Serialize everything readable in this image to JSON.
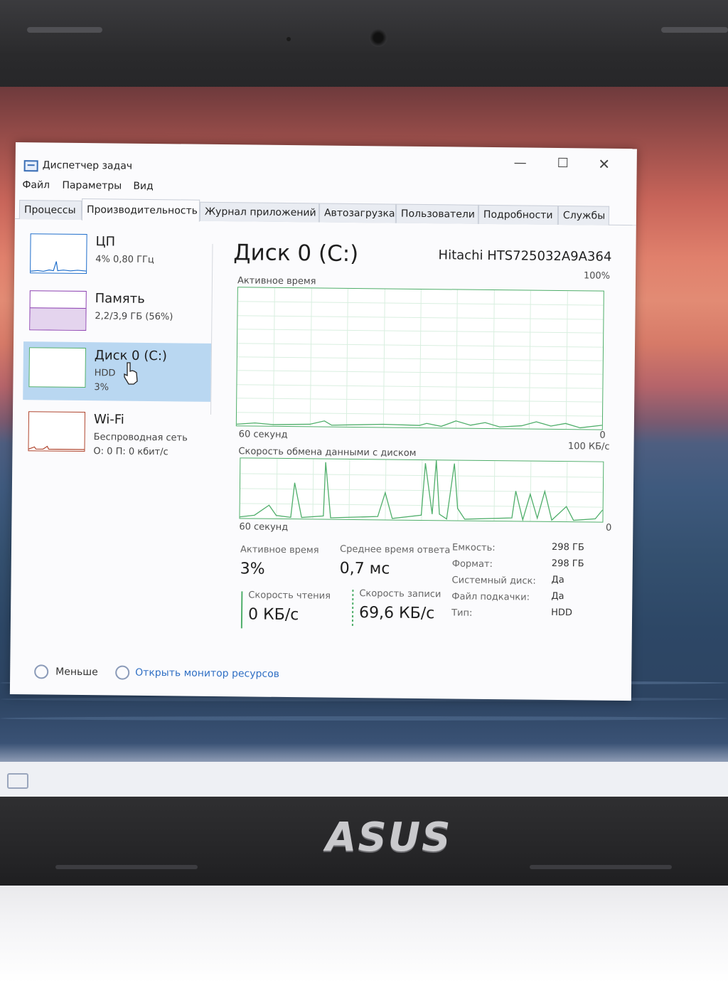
{
  "window": {
    "title": "Диспетчер задач",
    "controls": {
      "minimize": "—",
      "maximize": "☐",
      "close": "✕"
    }
  },
  "menu": [
    "Файл",
    "Параметры",
    "Вид"
  ],
  "tabs": [
    {
      "label": "Процессы",
      "active": false
    },
    {
      "label": "Производительность",
      "active": true
    },
    {
      "label": "Журнал приложений",
      "active": false
    },
    {
      "label": "Автозагрузка",
      "active": false
    },
    {
      "label": "Пользователи",
      "active": false
    },
    {
      "label": "Подробности",
      "active": false
    },
    {
      "label": "Службы",
      "active": false
    }
  ],
  "resources": {
    "cpu": {
      "name": "ЦП",
      "line1": "4% 0,80 ГГц",
      "color": "#1f6ecb"
    },
    "memory": {
      "name": "Память",
      "line1": "2,2/3,9 ГБ (56%)",
      "color": "#8b3fb0"
    },
    "disk": {
      "name": "Диск 0 (C:)",
      "line1": "HDD",
      "line2": "3%",
      "color": "#4fae6a"
    },
    "wifi": {
      "name": "Wi-Fi",
      "line1": "Беспроводная сеть",
      "line2": "О: 0 П: 0 кбит/с",
      "color": "#b0452e"
    }
  },
  "detail": {
    "title": "Диск 0 (C:)",
    "model": "Hitachi HTS725032A9A364",
    "graph1": {
      "label": "Активное время",
      "max": "100%",
      "min": "0",
      "time": "60 секунд"
    },
    "graph2": {
      "label": "Скорость обмена данными с диском",
      "max": "100 КБ/с",
      "min": "0",
      "time": "60 секунд"
    },
    "stats": {
      "active_time_label": "Активное время",
      "active_time_value": "3%",
      "response_label": "Среднее время ответа",
      "response_value": "0,7 мс",
      "read_label": "Скорость чтения",
      "read_value": "0 КБ/с",
      "write_label": "Скорость записи",
      "write_value": "69,6 КБ/с"
    },
    "properties": [
      {
        "label": "Емкость:",
        "value": "298 ГБ"
      },
      {
        "label": "Формат:",
        "value": "298 ГБ"
      },
      {
        "label": "Системный диск:",
        "value": "Да"
      },
      {
        "label": "Файл подкачки:",
        "value": "Да"
      },
      {
        "label": "Тип:",
        "value": "HDD"
      }
    ]
  },
  "footer": {
    "less": "Меньше",
    "resource_monitor": "Открыть монитор ресурсов"
  },
  "laptop": {
    "brand": "ASUS"
  },
  "colors": {
    "accent": "#4fae6a",
    "selected": "#b9d7f1",
    "link": "#2f6fc4"
  }
}
